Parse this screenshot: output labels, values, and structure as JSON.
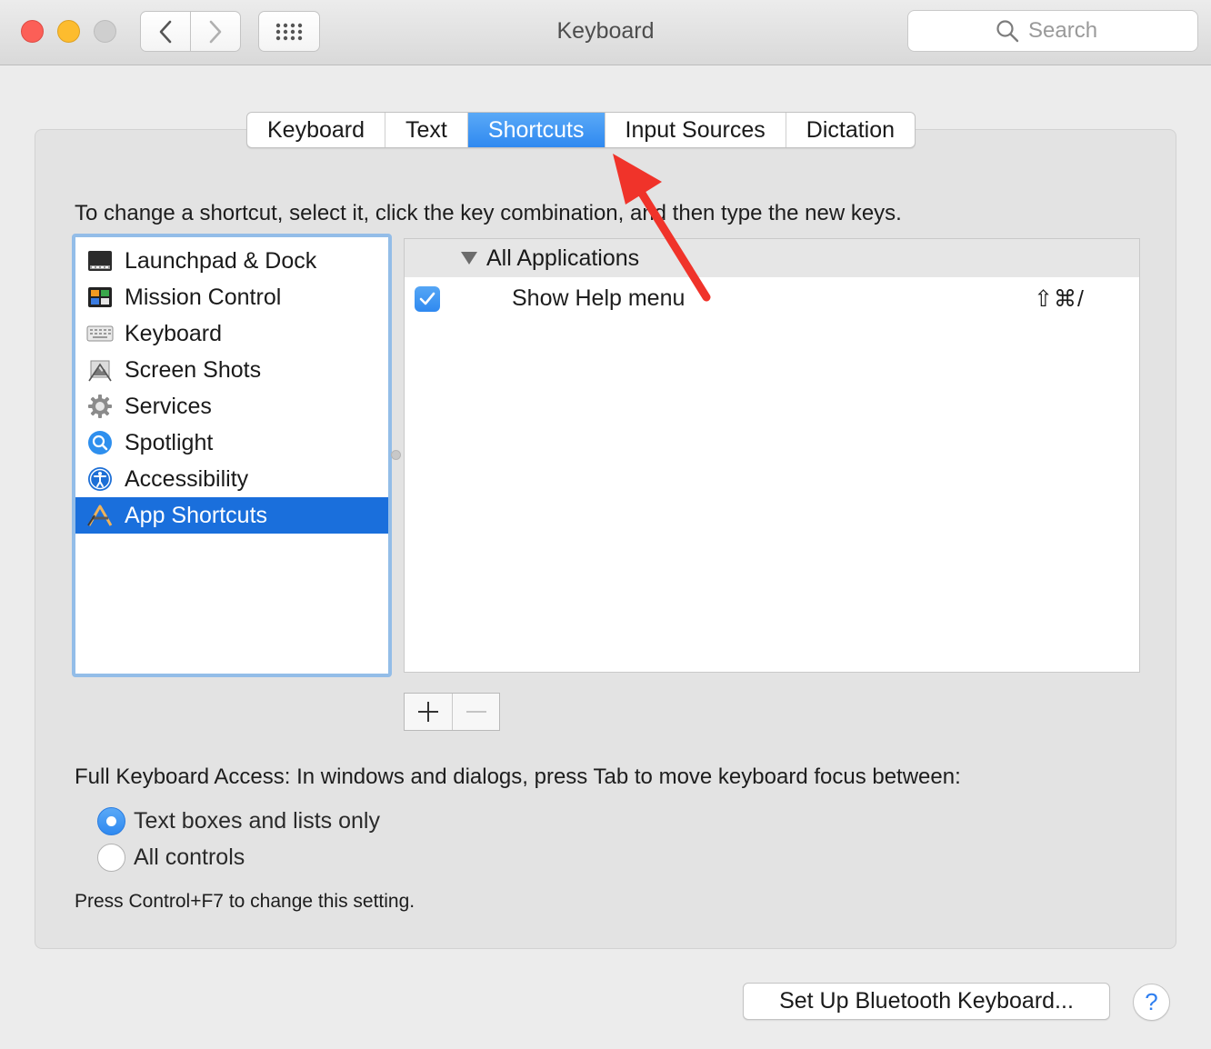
{
  "window": {
    "title": "Keyboard",
    "search_placeholder": "Search"
  },
  "tabs": [
    {
      "label": "Keyboard",
      "active": false
    },
    {
      "label": "Text",
      "active": false
    },
    {
      "label": "Shortcuts",
      "active": true
    },
    {
      "label": "Input Sources",
      "active": false
    },
    {
      "label": "Dictation",
      "active": false
    }
  ],
  "instructions": "To change a shortcut, select it, click the key combination, and then type the new keys.",
  "categories": [
    {
      "label": "Launchpad & Dock",
      "icon": "launchpad-dock-icon",
      "selected": false
    },
    {
      "label": "Mission Control",
      "icon": "mission-control-icon",
      "selected": false
    },
    {
      "label": "Keyboard",
      "icon": "keyboard-icon",
      "selected": false
    },
    {
      "label": "Screen Shots",
      "icon": "screenshot-icon",
      "selected": false
    },
    {
      "label": "Services",
      "icon": "gear-icon",
      "selected": false
    },
    {
      "label": "Spotlight",
      "icon": "spotlight-icon",
      "selected": false
    },
    {
      "label": "Accessibility",
      "icon": "accessibility-icon",
      "selected": false
    },
    {
      "label": "App Shortcuts",
      "icon": "app-store-icon",
      "selected": true
    }
  ],
  "shortcuts": {
    "group": "All Applications",
    "rows": [
      {
        "enabled": true,
        "label": "Show Help menu",
        "keys": "⇧⌘/"
      }
    ]
  },
  "buttons": {
    "add": "+",
    "remove": "—",
    "bluetooth": "Set Up Bluetooth Keyboard...",
    "help": "?"
  },
  "keyboard_access": {
    "label": "Full Keyboard Access: In windows and dialogs, press Tab to move keyboard focus between:",
    "options": [
      {
        "label": "Text boxes and lists only",
        "selected": true
      },
      {
        "label": "All controls",
        "selected": false
      }
    ],
    "hint": "Press Control+F7 to change this setting."
  },
  "colors": {
    "accent": "#2f89f0",
    "selection": "#1a6fdc",
    "annotation_arrow": "#f0332a"
  }
}
